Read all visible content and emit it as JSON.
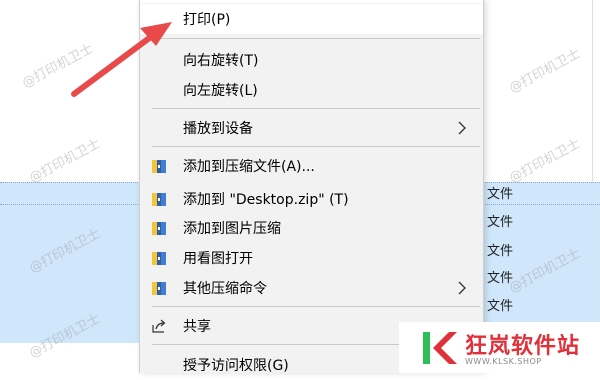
{
  "background": {
    "file_suffix": "文件",
    "rows": [
      "文件",
      "文件",
      "文件",
      "文件",
      "文件",
      "文件"
    ]
  },
  "watermark": "@打印机卫士",
  "menu": {
    "items": [
      {
        "label": "打印(P)"
      },
      {
        "label": "向右旋转(T)"
      },
      {
        "label": "向左旋转(L)"
      },
      {
        "label": "播放到设备"
      },
      {
        "label": "添加到压缩文件(A)..."
      },
      {
        "label": "添加到 \"Desktop.zip\" (T)"
      },
      {
        "label": "添加到图片压缩"
      },
      {
        "label": "用看图打开"
      },
      {
        "label": "其他压缩命令"
      },
      {
        "label": "共享"
      },
      {
        "label": "授予访问权限(G)"
      }
    ]
  },
  "icons": {
    "archive": "archive-icon",
    "share": "share-icon",
    "chevron": "chevron-right-icon",
    "arrow": "pointer-arrow"
  },
  "colors": {
    "arrow": "#e84a4a",
    "selection": "#cfe6fb",
    "menu_bg": "#f2f2f2",
    "logo_red": "#e0303a"
  },
  "logo": {
    "name": "狂岚软件站",
    "url": "WWW.KLSK.SHOP"
  }
}
